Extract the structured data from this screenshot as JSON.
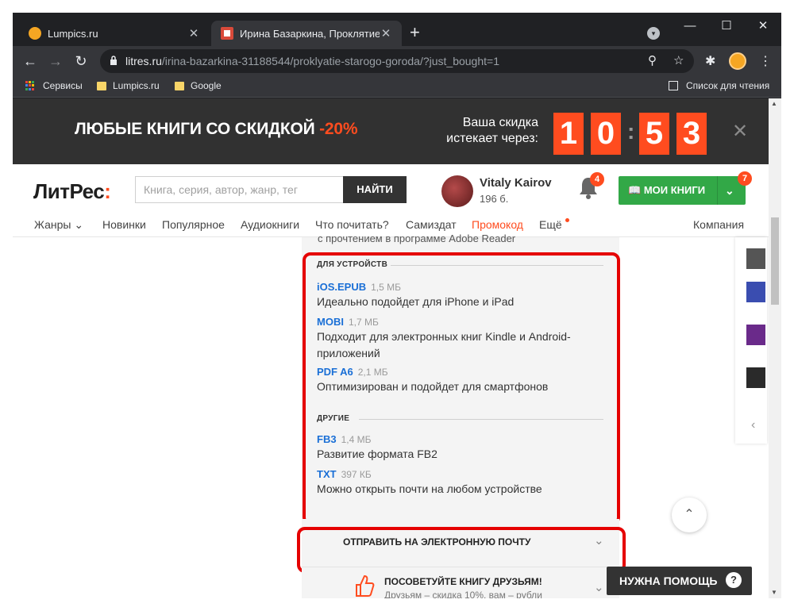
{
  "browser": {
    "tabs": [
      {
        "title": "Lumpics.ru",
        "favicon_color": "#f5a623"
      },
      {
        "title": "Ирина Базаркина, Проклятие С",
        "favicon_color": "#d94a3a"
      }
    ],
    "new_tab_symbol": "+",
    "close_symbol": "✕",
    "url_host": "litres.ru",
    "url_path": "/irina-bazarkina-31188544/proklyatie-starogo-goroda/?just_bought=1",
    "bookmarks": [
      "Сервисы",
      "Lumpics.ru",
      "Google"
    ],
    "reading_list": "Список для чтения"
  },
  "promo": {
    "headline": "ЛЮБЫЕ КНИГИ СО СКИДКОЙ",
    "discount": "-20%",
    "expires_label": "Ваша скидка истекает через:",
    "timer_digits": [
      "1",
      "0",
      "5",
      "3"
    ],
    "timer_separator": ":",
    "close_symbol": "✕"
  },
  "header": {
    "logo_main": "ЛитРес",
    "logo_accent": ":",
    "search_placeholder": "Книга, серия, автор, жанр, тег",
    "search_button": "НАЙТИ",
    "user_name": "Vitaly Kairov",
    "user_balance": "196 б.",
    "notifications_count": "4",
    "my_books_label": "МОИ КНИГИ",
    "my_books_count": "7"
  },
  "nav": {
    "items": [
      "Жанры",
      "Новинки",
      "Популярное",
      "Аудиокниги",
      "Что почитать?",
      "Самиздат",
      "Промокод",
      "Ещё"
    ],
    "company": "Компания"
  },
  "downloads": {
    "clipped_text": "с прочтением в программе Adobe Reader",
    "devices_title": "ДЛЯ УСТРОЙСТВ",
    "devices": [
      {
        "name": "iOS.EPUB",
        "size": "1,5 МБ",
        "desc": "Идеально подойдет для iPhone и iPad"
      },
      {
        "name": "MOBI",
        "size": "1,7 МБ",
        "desc": "Подходит для электронных книг Kindle и Android-приложений"
      },
      {
        "name": "PDF A6",
        "size": "2,1 МБ",
        "desc": "Оптимизирован и подойдет для смартфонов"
      }
    ],
    "other_title": "ДРУГИЕ",
    "other": [
      {
        "name": "FB3",
        "size": "1,4 МБ",
        "desc": "Развитие формата FB2"
      },
      {
        "name": "TXT",
        "size": "397 КБ",
        "desc": "Можно открыть почти на любом устройстве"
      }
    ]
  },
  "send_email": {
    "label": "ОТПРАВИТЬ НА ЭЛЕКТРОННУЮ ПОЧТУ"
  },
  "recommend": {
    "title": "ПОСОВЕТУЙТЕ КНИГУ ДРУЗЬЯМ!",
    "subtitle": "Друзьям – скидка 10%, вам – рубли"
  },
  "help": {
    "label": "НУЖНА ПОМОЩЬ",
    "icon": "?"
  },
  "colors": {
    "accent": "#ff4c1f",
    "green": "#32a847",
    "highlight": "#e50000",
    "link": "#1a6fd6"
  }
}
